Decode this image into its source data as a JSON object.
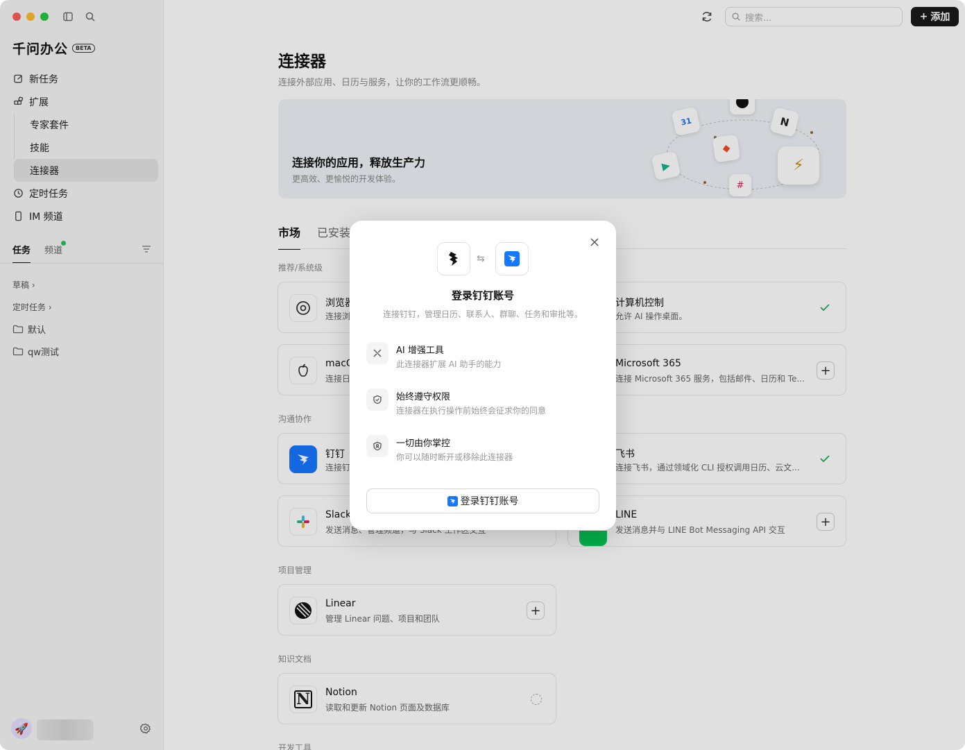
{
  "app": {
    "brand_name": "千问办公",
    "beta_badge": "BETA"
  },
  "sidebar": {
    "nav": [
      {
        "label": "新任务",
        "icon": "edit-icon"
      },
      {
        "label": "扩展",
        "icon": "extension-icon"
      }
    ],
    "sub_items": [
      "专家套件",
      "技能",
      "连接器"
    ],
    "nav2": [
      {
        "label": "定时任务",
        "icon": "clock-icon"
      },
      {
        "label": "IM 频道",
        "icon": "phone-icon"
      }
    ],
    "tabs": {
      "tasks": "任务",
      "channels": "频道"
    },
    "list": [
      {
        "label": "草稿 ›"
      },
      {
        "label": "定时任务 ›"
      },
      {
        "label": "默认"
      },
      {
        "label": "qw测试"
      }
    ]
  },
  "topbar": {
    "search_placeholder": "搜索...",
    "add_label": "添加"
  },
  "main": {
    "title": "连接器",
    "subtitle": "连接外部应用、日历与服务，让你的工作流更顺畅。",
    "banner": {
      "title": "连接你的应用，释放生产力",
      "subtitle": "更高效、更愉悦的开发体验。"
    },
    "tabs": {
      "market": "市场",
      "installed": "已安装"
    },
    "sections": {
      "recommended": "推荐/系统级",
      "communication": "沟通协作",
      "project": "项目管理",
      "knowledge": "知识文档",
      "dev": "开发工具"
    },
    "cards": {
      "browser": {
        "name": "浏览器",
        "desc": "连接浏"
      },
      "computer": {
        "name": "计算机控制",
        "desc": "允许 AI 操作桌面。"
      },
      "macos": {
        "name": "macO",
        "desc": "连接日"
      },
      "m365": {
        "name": "Microsoft 365",
        "desc": "连接 Microsoft 365 服务，包括邮件、日历和 Te..."
      },
      "dingtalk": {
        "name": "钉钉",
        "desc": "连接钉"
      },
      "feishu": {
        "name": "飞书",
        "desc": "连接飞书，通过领域化 CLI 授权调用日历、云文..."
      },
      "slack": {
        "name": "Slack",
        "desc": "发送消息、管理频道，与 Slack 工作区交互"
      },
      "line": {
        "name": "LINE",
        "desc": "发送消息并与 LINE Bot Messaging API 交互"
      },
      "linear": {
        "name": "Linear",
        "desc": "管理 Linear 问题、项目和团队"
      },
      "notion": {
        "name": "Notion",
        "desc": "读取和更新 Notion 页面及数据库"
      }
    }
  },
  "modal": {
    "title": "登录钉钉账号",
    "subtitle": "连接钉钉，管理日历、联系人、群聊、任务和审批等。",
    "features": [
      {
        "title": "AI 增强工具",
        "desc": "此连接器扩展 AI 助手的能力",
        "icon": "tools-icon"
      },
      {
        "title": "始终遵守权限",
        "desc": "连接器在执行操作前始终会征求你的同意",
        "icon": "shield-check-icon"
      },
      {
        "title": "一切由你掌控",
        "desc": "你可以随时断开或移除此连接器",
        "icon": "shield-user-icon"
      }
    ],
    "button_label": "登录钉钉账号"
  },
  "colors": {
    "accent_dark": "#1a1a1a",
    "success": "#22a85a",
    "dingtalk_blue": "#1677ff"
  }
}
